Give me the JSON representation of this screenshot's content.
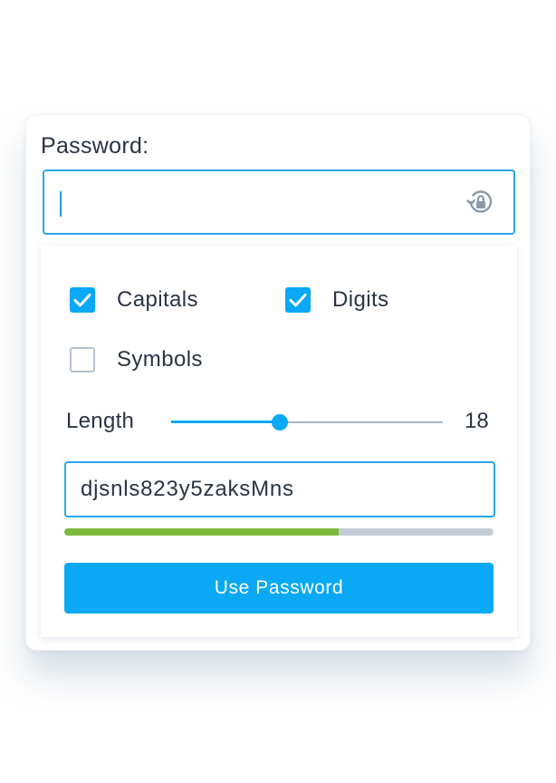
{
  "password": {
    "label": "Password:",
    "value": ""
  },
  "options": {
    "capitals": {
      "label": "Capitals",
      "checked": true
    },
    "digits": {
      "label": "Digits",
      "checked": true
    },
    "symbols": {
      "label": "Symbols",
      "checked": false
    }
  },
  "length": {
    "label": "Length",
    "value": "18",
    "slider_fraction": 0.4
  },
  "generated": {
    "value": "djsnls823y5zaksMns"
  },
  "strength": {
    "fraction": 0.64
  },
  "actions": {
    "use_password_label": "Use Password"
  },
  "colors": {
    "accent": "#0aa8f5",
    "field_border": "#2ba6ee",
    "strength_good": "#7cba3d",
    "text": "#2b3443"
  },
  "icons": {
    "regenerate": "refresh-lock-icon",
    "check": "check-icon"
  }
}
